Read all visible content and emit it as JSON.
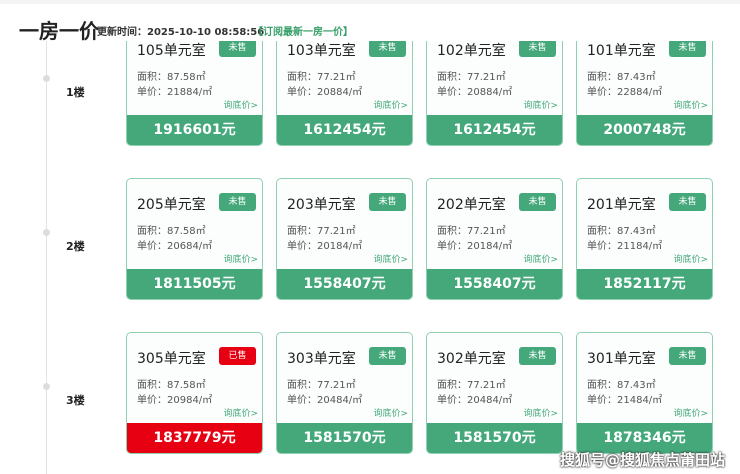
{
  "header": {
    "title": "一房一价",
    "updated": "更新时间：2025-10-10 08:58:56",
    "subscribe": "【订阅最新一房一价】"
  },
  "watermark": "搜狐号@搜狐焦点莆田站",
  "floors": [
    {
      "label": "1楼",
      "units": [
        {
          "room": "105单元室",
          "status": "未售",
          "area": "面积：87.58㎡",
          "unit_price": "单价：21884/㎡",
          "ask": "询底价>",
          "price": "1916601元",
          "sold": false
        },
        {
          "room": "103单元室",
          "status": "未售",
          "area": "面积：77.21㎡",
          "unit_price": "单价：20884/㎡",
          "ask": "询底价>",
          "price": "1612454元",
          "sold": false
        },
        {
          "room": "102单元室",
          "status": "未售",
          "area": "面积：77.21㎡",
          "unit_price": "单价：20884/㎡",
          "ask": "询底价>",
          "price": "1612454元",
          "sold": false
        },
        {
          "room": "101单元室",
          "status": "未售",
          "area": "面积：87.43㎡",
          "unit_price": "单价：22884/㎡",
          "ask": "询底价>",
          "price": "2000748元",
          "sold": false
        }
      ]
    },
    {
      "label": "2楼",
      "units": [
        {
          "room": "205单元室",
          "status": "未售",
          "area": "面积：87.58㎡",
          "unit_price": "单价：20684/㎡",
          "ask": "询底价>",
          "price": "1811505元",
          "sold": false
        },
        {
          "room": "203单元室",
          "status": "未售",
          "area": "面积：77.21㎡",
          "unit_price": "单价：20184/㎡",
          "ask": "询底价>",
          "price": "1558407元",
          "sold": false
        },
        {
          "room": "202单元室",
          "status": "未售",
          "area": "面积：77.21㎡",
          "unit_price": "单价：20184/㎡",
          "ask": "询底价>",
          "price": "1558407元",
          "sold": false
        },
        {
          "room": "201单元室",
          "status": "未售",
          "area": "面积：87.43㎡",
          "unit_price": "单价：21184/㎡",
          "ask": "询底价>",
          "price": "1852117元",
          "sold": false
        }
      ]
    },
    {
      "label": "3楼",
      "units": [
        {
          "room": "305单元室",
          "status": "已售",
          "area": "面积：87.58㎡",
          "unit_price": "单价：20984/㎡",
          "ask": "询底价>",
          "price": "1837779元",
          "sold": true
        },
        {
          "room": "303单元室",
          "status": "未售",
          "area": "面积：77.21㎡",
          "unit_price": "单价：20484/㎡",
          "ask": "询底价>",
          "price": "1581570元",
          "sold": false
        },
        {
          "room": "302单元室",
          "status": "未售",
          "area": "面积：77.21㎡",
          "unit_price": "单价：20484/㎡",
          "ask": "询底价>",
          "price": "1581570元",
          "sold": false
        },
        {
          "room": "301单元室",
          "status": "未售",
          "area": "面积：87.43㎡",
          "unit_price": "单价：21484/㎡",
          "ask": "询底价>",
          "price": "1878346元",
          "sold": false
        }
      ]
    }
  ]
}
